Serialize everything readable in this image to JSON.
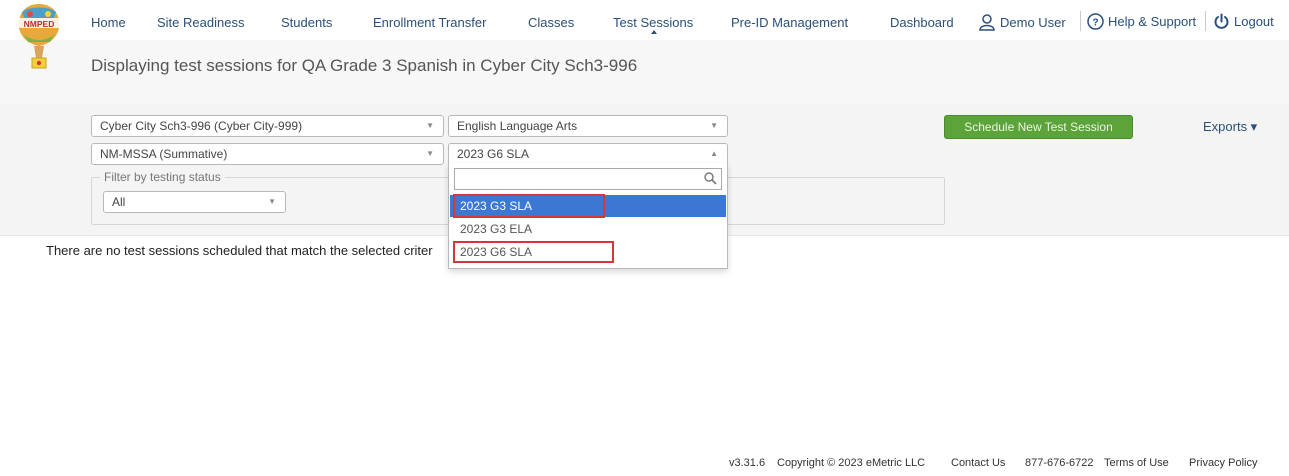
{
  "logo": {
    "text": "NMPED"
  },
  "nav": {
    "items": [
      "Home",
      "Site Readiness",
      "Students",
      "Enrollment Transfer",
      "Classes",
      "Test Sessions",
      "Pre-ID Management",
      "Dashboard"
    ],
    "active": "Test Sessions",
    "user": "Demo User",
    "help": "Help & Support",
    "logout": "Logout"
  },
  "page": {
    "title": "Displaying test sessions for QA Grade 3 Spanish in Cyber City Sch3-996"
  },
  "filters": {
    "school": "Cyber City Sch3-996 (Cyber City-999)",
    "subject": "English Language Arts",
    "assessment": "NM-MSSA (Summative)",
    "test": "2023 G6 SLA",
    "status_legend": "Filter by testing status",
    "status_value": "All"
  },
  "actions": {
    "schedule": "Schedule New Test Session",
    "exports": "Exports ▾"
  },
  "dropdown": {
    "search_value": "",
    "options": [
      "2023 G3 SLA",
      "2023 G3 ELA",
      "2023 G6 SLA"
    ],
    "highlighted_option": "2023 G3 SLA"
  },
  "message": {
    "empty": "There are no test sessions scheduled that match the selected criter"
  },
  "footer": {
    "version": "v3.31.6",
    "copyright": "Copyright © 2023 eMetric LLC",
    "contact": "Contact Us",
    "phone": "877-676-6722",
    "terms": "Terms of Use",
    "privacy": "Privacy Policy"
  },
  "colors": {
    "link": "#2a4f7a",
    "button_green": "#5ca33a",
    "selected_option": "#3a78d4",
    "highlight_red": "#d9343a"
  }
}
